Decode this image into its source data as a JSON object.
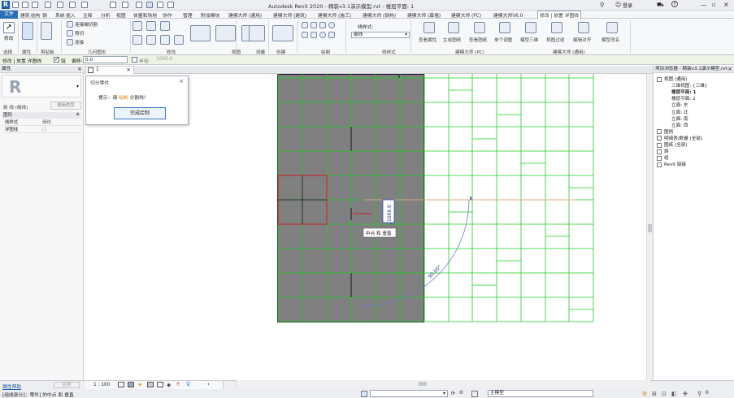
{
  "titlebar": {
    "title": "Autodesk Revit 2020 - 精装v3.1演示模型.rvt - 楼层平面: 1",
    "search_label": "登录",
    "help_label": "?"
  },
  "menubar": {
    "file": "文件",
    "items": [
      "建筑",
      "结构",
      "钢",
      "系统",
      "插入",
      "注释",
      "分析",
      "视图",
      "体量和场地",
      "协作",
      "管理",
      "附加模块",
      "建模大师 (通用)",
      "建模大师 (建筑)",
      "建模大师 (施工)",
      "建模大师 (钢构)",
      "建模大师 (幕墙)",
      "建模大师 (PC)",
      "建模大师V6.0",
      "修改 | 放置 详图线"
    ]
  },
  "ribbon": {
    "groups": [
      "选择",
      "属性",
      "剪贴板",
      "几何图形",
      "修改",
      "视图",
      "测量",
      "创建",
      "绘制",
      "线样式",
      "建模大师 (PC)",
      "建模大师 (通用)"
    ],
    "modify_label": "修改",
    "linestyle_label": "线样式:",
    "linestyle_value": "细线",
    "tools": [
      "查看属性",
      "生成图纸",
      "查看图纸",
      "单个调整",
      "模型三维",
      "视图过滤",
      "编辑对齐",
      "模型改名"
    ],
    "clipboard": [
      "连接端切割",
      "剪切",
      "连接"
    ]
  },
  "optbar": {
    "context": "修改 | 放置 详图线",
    "chain_label": "链",
    "offset_label": "偏移:",
    "offset_value": "0.0",
    "radius_label": "半径:",
    "radius_value": "1000.0"
  },
  "properties": {
    "header": "属性",
    "type_selector": "R",
    "filter_label": "新 线 (细线)",
    "edit_type": "编辑类型",
    "section": "图形",
    "rows": [
      {
        "k": "线样式",
        "v": "细线"
      },
      {
        "k": "详图线",
        "v": "☐"
      }
    ],
    "help_link": "属性帮助",
    "apply": "应用"
  },
  "view_tab": {
    "label": "1"
  },
  "dialog": {
    "title": "切分零件",
    "message_prefix": "提示：请 ",
    "message_highlight": "绘制",
    "message_suffix": " 分割线!",
    "button": "完成绘制"
  },
  "canvas": {
    "dimension_value": "1000.0",
    "angle_value": "90.00°",
    "snap_tooltip": "中点 和 垂直",
    "colors": {
      "slab": "#808080",
      "grid": "#22cc22",
      "red": "#cc2222",
      "blue": "#3355bb",
      "arc": "#6a7fbf"
    }
  },
  "project_browser": {
    "header": "项目浏览器 - 精装v3.1演示模型.rvt",
    "items": [
      {
        "label": "视图 (通用)",
        "level": 0,
        "icon": "minus"
      },
      {
        "label": "三维视图: {三维}",
        "level": 1
      },
      {
        "label": "楼层平面: 1",
        "level": 1,
        "bold": true
      },
      {
        "label": "楼层平面: 2",
        "level": 1
      },
      {
        "label": "立面: 东",
        "level": 1
      },
      {
        "label": "立面: 北",
        "level": 1
      },
      {
        "label": "立面: 南",
        "level": 1
      },
      {
        "label": "立面: 西",
        "level": 1
      },
      {
        "label": "图例",
        "level": 0
      },
      {
        "label": "明细表/数量 (全部)",
        "level": 0
      },
      {
        "label": "图纸 (全部)",
        "level": 0
      },
      {
        "label": "族",
        "level": 0,
        "icon": "plus"
      },
      {
        "label": "组",
        "level": 0,
        "icon": "plus"
      },
      {
        "label": "Revit 链接",
        "level": 0,
        "icon": "link"
      }
    ]
  },
  "statusbar": {
    "scale": "1 : 100",
    "status_text": "[组成部分]：零件] 的中点 和 垂直",
    "model_label": "主模型",
    "zero": ":0",
    "filter_count": "0"
  }
}
